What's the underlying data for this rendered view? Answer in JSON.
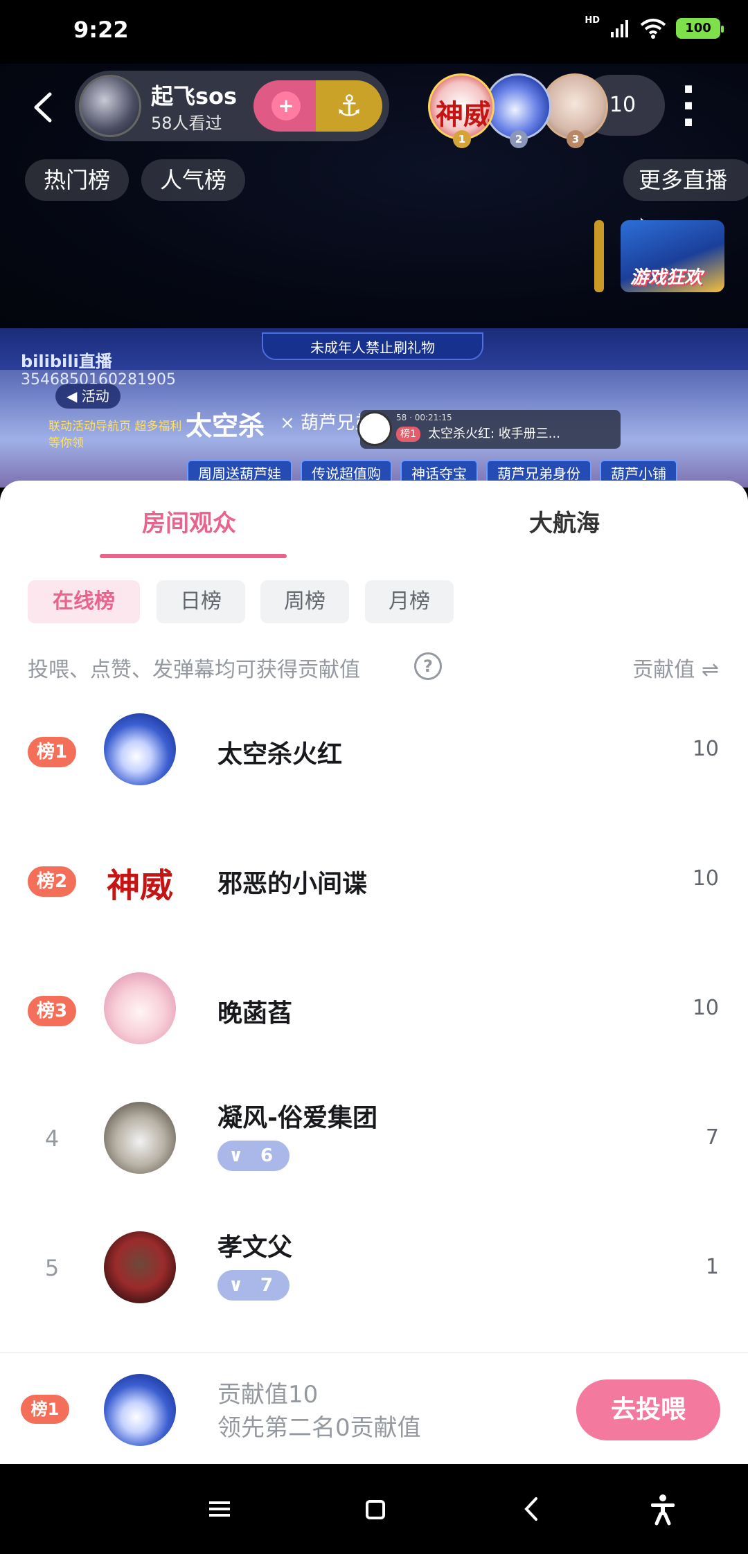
{
  "status_bar": {
    "time": "9:22",
    "network": "HD",
    "battery": "100"
  },
  "header": {
    "host_name": "起飞sos",
    "viewers": "58人看过",
    "online_count": "10",
    "chips": {
      "hot": "热门榜",
      "popular": "人气榜",
      "more": "更多直播"
    }
  },
  "video": {
    "notice": "未成年人禁止刷礼物",
    "logo": "bilibili直播",
    "room_id": "3546850160281905",
    "activity": "活动",
    "side_text": "联动活动导航页 超多福利等你领",
    "title_a": "太空杀",
    "title_b": "× 葫芦兄弟",
    "banner_text": "游戏狂欢",
    "msg_meta": "58 · 00:21:15",
    "msg_rank": "榜1",
    "msg_text": "太空杀火红: 收手册三...",
    "tabs": [
      "周周送葫芦娃",
      "传说超值购",
      "神话夺宝",
      "葫芦兄弟身份",
      "葫芦小铺"
    ]
  },
  "sheet": {
    "tabs": {
      "audience": "房间观众",
      "navigation": "大航海"
    },
    "subtabs": [
      "在线榜",
      "日榜",
      "周榜",
      "月榜"
    ],
    "hint": "投喂、点赞、发弹幕均可获得贡献值",
    "contrib_header": "贡献值 ⇌",
    "rows": [
      {
        "rank": "榜1",
        "name": "太空杀火红",
        "score": "10"
      },
      {
        "rank": "榜2",
        "name": "邪恶的小间谍",
        "score": "10",
        "avatar_text": "神威"
      },
      {
        "rank": "榜3",
        "name": "晚菡萏",
        "score": "10"
      },
      {
        "rank": "4",
        "name": "凝风-俗爱集团",
        "score": "7",
        "level": "6"
      },
      {
        "rank": "5",
        "name": "孝文父",
        "score": "1",
        "level": "7"
      }
    ]
  },
  "self": {
    "rank": "榜1",
    "line1": "贡献值10",
    "line2": "领先第二名0贡献值",
    "button": "去投喂"
  },
  "fans": {
    "r1": "1",
    "r2": "2",
    "r3": "3",
    "r1_text": "神威"
  }
}
